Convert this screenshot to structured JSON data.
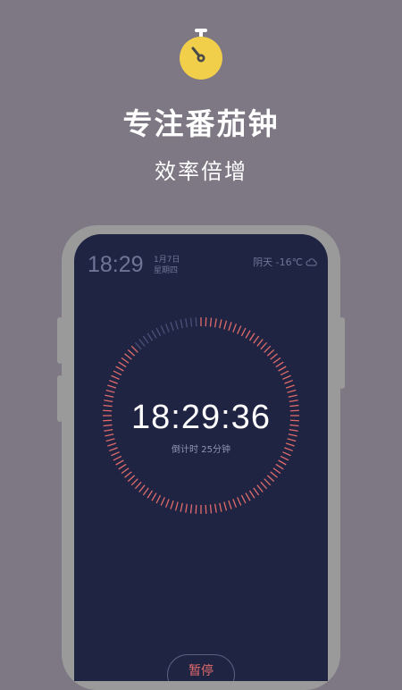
{
  "promo": {
    "headline": "专注番茄钟",
    "subhead": "效率倍增",
    "icon": "stopwatch-icon",
    "icon_color": "#f2cf4a"
  },
  "status_bar": {
    "time": "18:29",
    "date_line1": "1月7日",
    "date_line2": "星期四",
    "weather_text": "阴天 -16℃",
    "weather_icon": "cloud-icon"
  },
  "timer": {
    "display": "18:29:36",
    "label": "倒计时 25分钟",
    "progress": 0.12,
    "accent_color": "#e06b6b",
    "track_color": "#4a5078"
  },
  "controls": {
    "pause_label": "暂停"
  },
  "colors": {
    "background": "#7d7883",
    "screen": "#202443",
    "frame": "#9a9a9a"
  }
}
